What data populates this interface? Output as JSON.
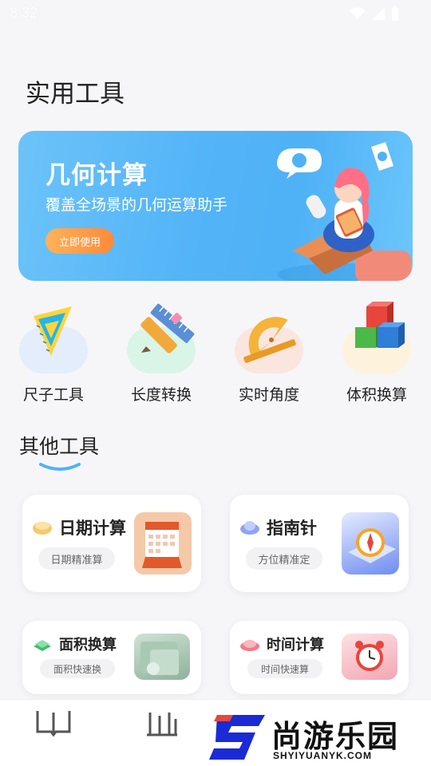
{
  "status_bar": {
    "time": "8:32"
  },
  "page": {
    "title": "实用工具"
  },
  "banner": {
    "title": "几何计算",
    "subtitle": "覆盖全场景的几何运算助手",
    "button_label": "立即使用"
  },
  "tools": [
    {
      "label": "尺子工具",
      "icon": "ruler-icon",
      "bg": "#e3edfb"
    },
    {
      "label": "长度转换",
      "icon": "pencil-ruler-icon",
      "bg": "#d9f5e8"
    },
    {
      "label": "实时角度",
      "icon": "protractor-icon",
      "bg": "#fbe6df"
    },
    {
      "label": "体积换算",
      "icon": "cubes-icon",
      "bg": "#fdf3dc"
    }
  ],
  "section": {
    "title": "其他工具"
  },
  "cards": [
    {
      "title": "日期计算",
      "subtitle": "日期精准算",
      "icon": "calendar-icon"
    },
    {
      "title": "指南针",
      "subtitle": "方位精准定",
      "icon": "compass-icon"
    },
    {
      "title": "面积换算",
      "subtitle": "面积快速换",
      "icon": "area-box-icon"
    },
    {
      "title": "时间计算",
      "subtitle": "时间快速算",
      "icon": "alarm-clock-icon"
    }
  ],
  "watermark": {
    "brand": "尚游乐园",
    "url": "SHYIYUANYK.COM"
  },
  "colors": {
    "accent": "#4fb2f6",
    "button": "#ff9a45",
    "underline": "#4fb2f6"
  }
}
